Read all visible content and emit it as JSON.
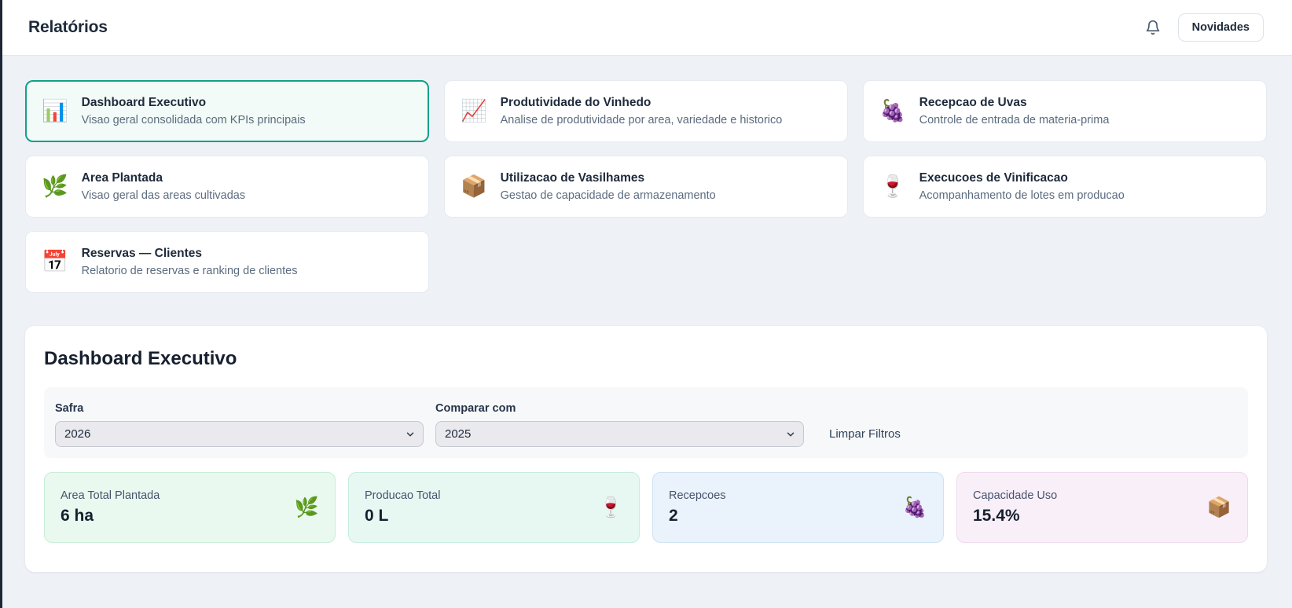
{
  "header": {
    "title": "Relatórios",
    "novidades_label": "Novidades"
  },
  "icons": {
    "bell": "bell-outline",
    "chevron": "chevron-down"
  },
  "report_cards": [
    {
      "icon": "📊",
      "title": "Dashboard Executivo",
      "subtitle": "Visao geral consolidada com KPIs principais",
      "selected": true
    },
    {
      "icon": "📈",
      "title": "Produtividade do Vinhedo",
      "subtitle": "Analise de produtividade por area, variedade e historico",
      "selected": false
    },
    {
      "icon": "🍇",
      "title": "Recepcao de Uvas",
      "subtitle": "Controle de entrada de materia-prima",
      "selected": false
    },
    {
      "icon": "🌿",
      "title": "Area Plantada",
      "subtitle": "Visao geral das areas cultivadas",
      "selected": false
    },
    {
      "icon": "📦",
      "title": "Utilizacao de Vasilhames",
      "subtitle": "Gestao de capacidade de armazenamento",
      "selected": false
    },
    {
      "icon": "🍷",
      "title": "Execucoes de Vinificacao",
      "subtitle": "Acompanhamento de lotes em producao",
      "selected": false
    },
    {
      "icon": "📅",
      "title": "Reservas — Clientes",
      "subtitle": "Relatorio de reservas e ranking de clientes",
      "selected": false
    }
  ],
  "dashboard": {
    "title": "Dashboard Executivo",
    "filters": {
      "safra_label": "Safra",
      "safra_value": "2026",
      "comparar_label": "Comparar com",
      "comparar_value": "2025",
      "clear_label": "Limpar Filtros"
    },
    "kpis": [
      {
        "label": "Area Total Plantada",
        "value": "6 ha",
        "icon": "🌿",
        "bg": "#e9f9ef",
        "border": "#c9edd6"
      },
      {
        "label": "Producao Total",
        "value": "0 L",
        "icon": "🍷",
        "bg": "#e7f8f3",
        "border": "#c6ece2"
      },
      {
        "label": "Recepcoes",
        "value": "2",
        "icon": "🍇",
        "bg": "#eaf2fb",
        "border": "#cfe2f3"
      },
      {
        "label": "Capacidade Uso",
        "value": "15.4%",
        "icon": "📦",
        "bg": "#f9eff9",
        "border": "#eedaee"
      }
    ]
  },
  "colors": {
    "page_bg": "#eef1f6",
    "sidebar_edge": "#1c2634",
    "selected_card_border": "#12a089",
    "selected_card_bg": "#f2fbf7",
    "text_primary": "#1e2a3b",
    "text_secondary": "#5b6b7f"
  }
}
